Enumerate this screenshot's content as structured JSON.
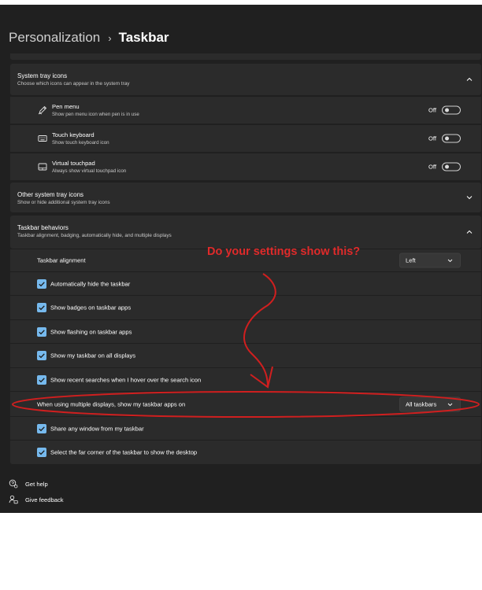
{
  "breadcrumb": {
    "parent": "Personalization",
    "separator": "›",
    "current": "Taskbar"
  },
  "system_tray": {
    "title": "System tray icons",
    "subtitle": "Choose which icons can appear in the system tray",
    "items": [
      {
        "title": "Pen menu",
        "subtitle": "Show pen menu icon when pen is in use",
        "state": "Off",
        "icon": "pen-icon"
      },
      {
        "title": "Touch keyboard",
        "subtitle": "Show touch keyboard icon",
        "state": "Off",
        "icon": "keyboard-icon"
      },
      {
        "title": "Virtual touchpad",
        "subtitle": "Always show virtual touchpad icon",
        "state": "Off",
        "icon": "touchpad-icon"
      }
    ]
  },
  "other_tray": {
    "title": "Other system tray icons",
    "subtitle": "Show or hide additional system tray icons"
  },
  "behaviors": {
    "title": "Taskbar behaviors",
    "subtitle": "Taskbar alignment, badging, automatically hide, and multiple displays",
    "alignment_label": "Taskbar alignment",
    "alignment_value": "Left",
    "checks": [
      "Automatically hide the taskbar",
      "Show badges on taskbar apps",
      "Show flashing on taskbar apps",
      "Show my taskbar on all displays",
      "Show recent searches when I hover over the search icon"
    ],
    "multi_label": "When using multiple displays, show my taskbar apps on",
    "multi_value": "All taskbars",
    "checks2": [
      "Share any window from my taskbar",
      "Select the far corner of the taskbar to show the desktop"
    ]
  },
  "footer": {
    "help": "Get help",
    "feedback": "Give feedback"
  },
  "annotation": {
    "text": "Do your settings show this?",
    "color": "#e02a2a"
  },
  "colors": {
    "background": "#202020",
    "card": "#2b2b2b",
    "accent": "#76b9ed"
  }
}
